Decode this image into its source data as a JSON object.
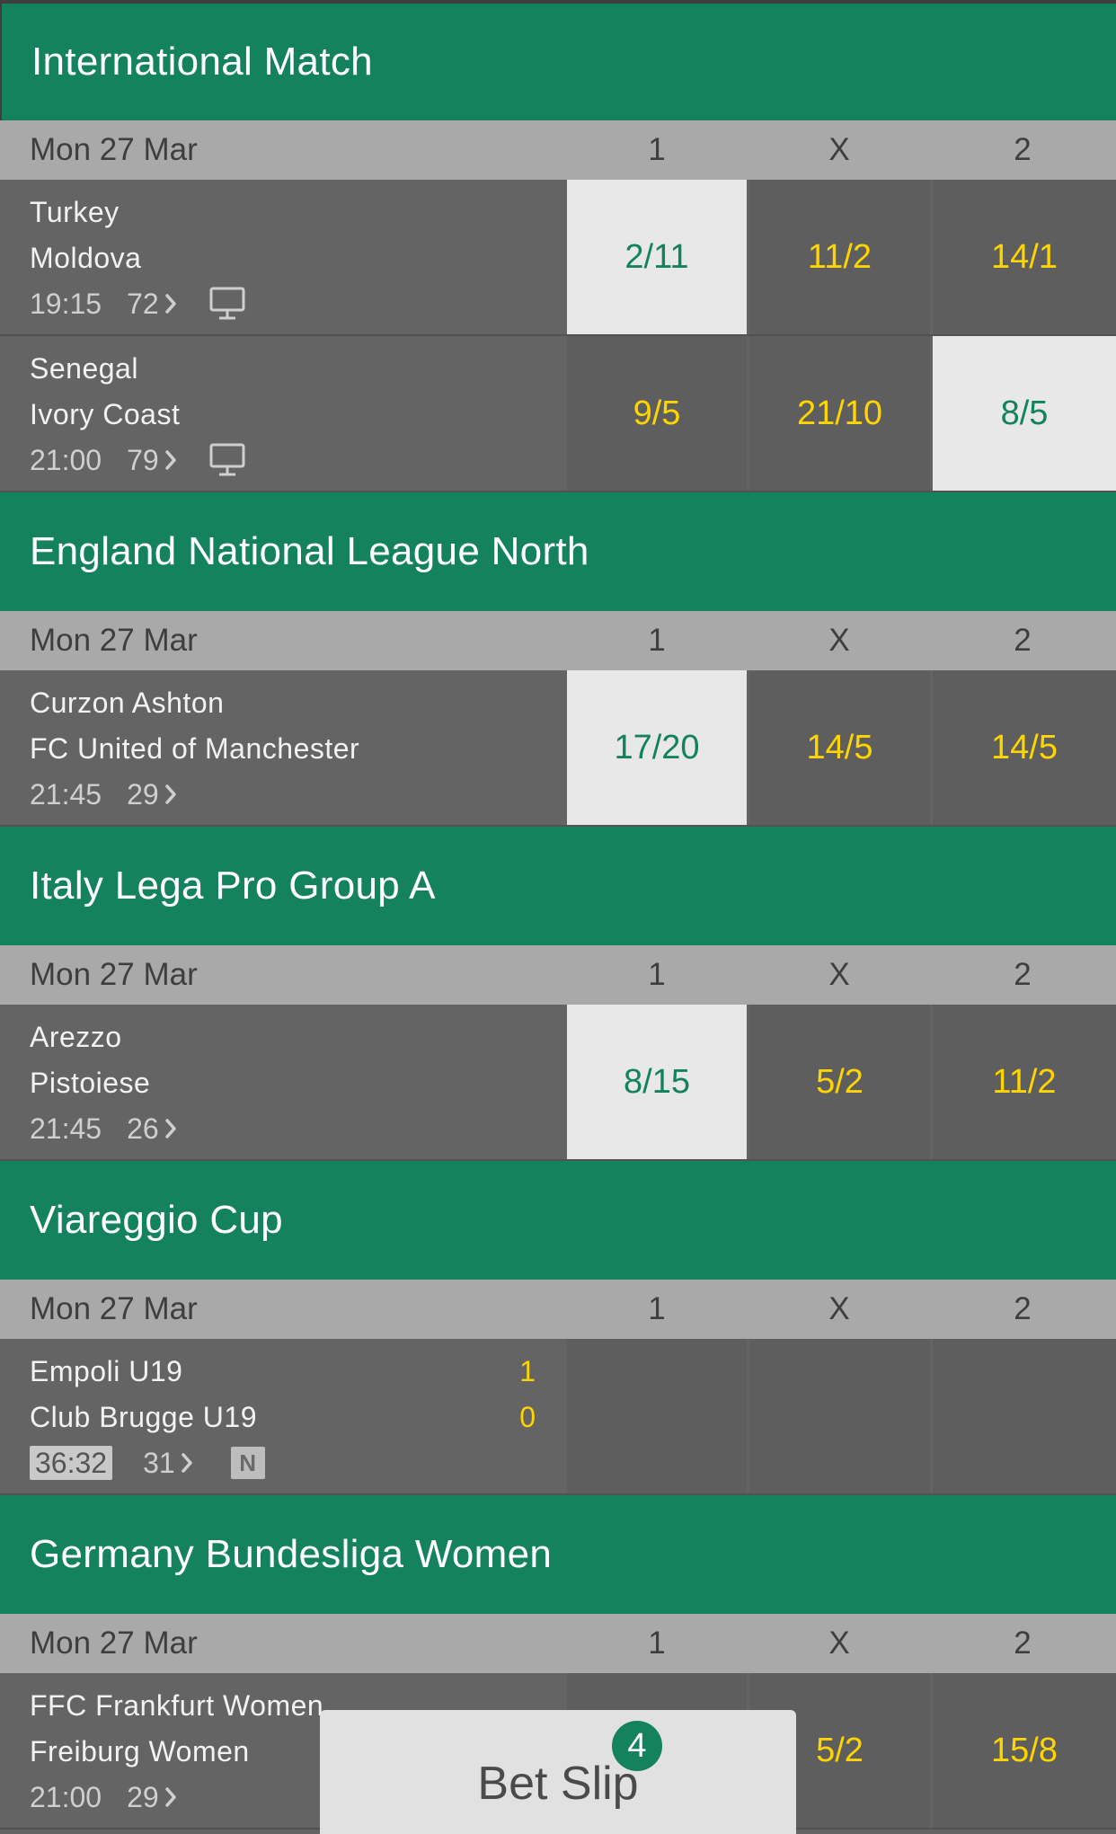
{
  "columns": {
    "home": "1",
    "draw": "X",
    "away": "2"
  },
  "competitions": [
    {
      "name": "International Match",
      "date": "Mon 27 Mar",
      "events": [
        {
          "home": "Turkey",
          "away": "Moldova",
          "time": "19:15",
          "markets": "72",
          "tv": true,
          "odds": [
            "2/11",
            "11/2",
            "14/1"
          ],
          "selected": 0
        },
        {
          "home": "Senegal",
          "away": "Ivory Coast",
          "time": "21:00",
          "markets": "79",
          "tv": true,
          "odds": [
            "9/5",
            "21/10",
            "8/5"
          ],
          "selected": 2
        }
      ]
    },
    {
      "name": "England National League North",
      "date": "Mon 27 Mar",
      "events": [
        {
          "home": "Curzon Ashton",
          "away": "FC United of Manchester",
          "time": "21:45",
          "markets": "29",
          "odds": [
            "17/20",
            "14/5",
            "14/5"
          ],
          "selected": 0
        }
      ]
    },
    {
      "name": "Italy Lega Pro Group A",
      "date": "Mon 27 Mar",
      "events": [
        {
          "home": "Arezzo",
          "away": "Pistoiese",
          "time": "21:45",
          "markets": "26",
          "odds": [
            "8/15",
            "5/2",
            "11/2"
          ],
          "selected": 0
        }
      ]
    },
    {
      "name": "Viareggio Cup",
      "date": "Mon 27 Mar",
      "events": [
        {
          "home": "Empoli U19",
          "away": "Club Brugge U19",
          "clock": "36:32",
          "markets": "31",
          "live": true,
          "badge": "N",
          "score_home": "1",
          "score_away": "0",
          "odds": [
            "",
            "",
            ""
          ],
          "selected": -1
        }
      ]
    },
    {
      "name": "Germany Bundesliga Women",
      "date": "Mon 27 Mar",
      "events": [
        {
          "home": "FFC Frankfurt Women",
          "away": "Freiburg Women",
          "time": "21:00",
          "markets": "29",
          "odds": [
            "",
            "5/2",
            "15/8"
          ],
          "selected": -1
        }
      ]
    }
  ],
  "betslip": {
    "label": "Bet Slip",
    "count": "4"
  },
  "colors": {
    "brand_green": "#14825c",
    "odds_yellow": "#ffd500",
    "selected_bg": "#e8e8e8"
  },
  "icons": [
    "chevron-right-icon",
    "tv-monitor-icon",
    "neutral-venue-icon"
  ]
}
